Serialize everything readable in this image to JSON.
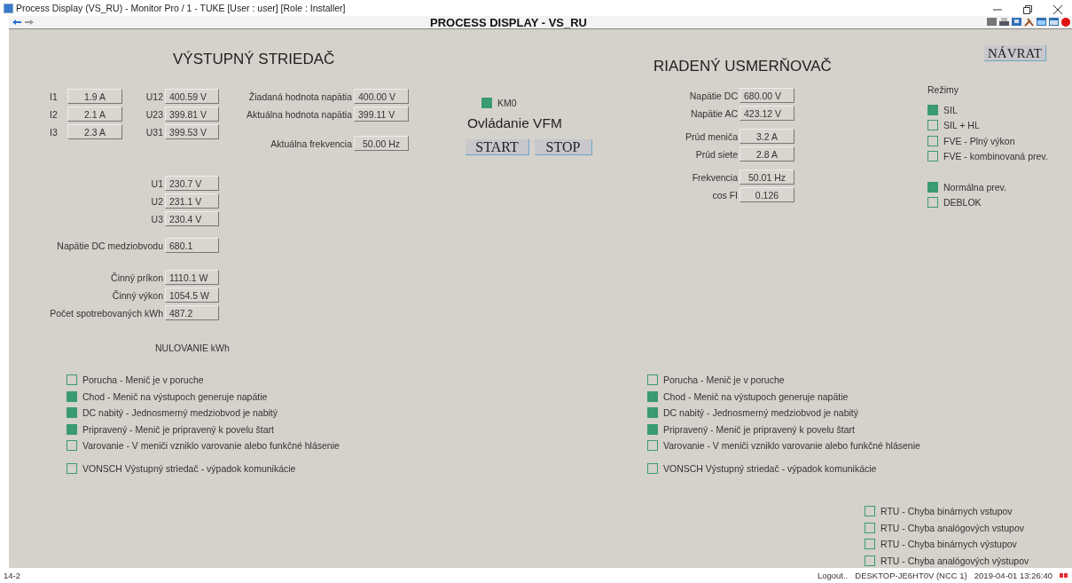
{
  "window": {
    "title": "Process Display (VS_RU) - Monitor Pro / 1 - TUKE [User : user] [Role : Installer]"
  },
  "toolbar": {
    "title": "PROCESS DISPLAY - VS_RU"
  },
  "inverter": {
    "title": "VÝSTUPNÝ STRIEDAČ",
    "currents": [
      {
        "label": "I1",
        "value": "1.9 A"
      },
      {
        "label": "I2",
        "value": "2.1 A"
      },
      {
        "label": "I3",
        "value": "2.3 A"
      }
    ],
    "line_voltages": [
      {
        "label": "U12",
        "value": "400.59 V"
      },
      {
        "label": "U23",
        "value": "399.81 V"
      },
      {
        "label": "U31",
        "value": "399.53 V"
      }
    ],
    "setpoints": [
      {
        "label": "Žiadaná hodnota napätia",
        "value": "400.00 V"
      },
      {
        "label": "Aktuálna hodnota napätia",
        "value": "399.11 V"
      }
    ],
    "frequency": {
      "label": "Aktuálna frekvencia",
      "value": "50.00 Hz"
    },
    "phase_voltages": [
      {
        "label": "U1",
        "value": "230.7 V"
      },
      {
        "label": "U2",
        "value": "231.1 V"
      },
      {
        "label": "U3",
        "value": "230.4 V"
      }
    ],
    "dc_link": {
      "label": "Napätie DC medziobvodu",
      "value": "680.1"
    },
    "power": [
      {
        "label": "Činný príkon",
        "value": "1110.1 W"
      },
      {
        "label": "Činný výkon",
        "value": "1054.5 W"
      },
      {
        "label": "Počet spotrebovaných kWh",
        "value": "487.2"
      }
    ],
    "reset": "NULOVANIE kWh",
    "status": [
      {
        "label": "Porucha - Menič je v poruche",
        "on": false
      },
      {
        "label": "Chod - Menič na výstupoch generuje napätie",
        "on": true
      },
      {
        "label": "DC nabitý - Jednosmerný medziobvod je nabitý",
        "on": true
      },
      {
        "label": "Pripravený - Menič je pripravený k povelu štart",
        "on": true
      },
      {
        "label": "Varovanie - V meniči vzniklo varovanie alebo funkčné hlásenie",
        "on": false
      }
    ],
    "comm": {
      "label": "VONSCH Výstupný striedač - výpadok komunikácie",
      "on": false
    }
  },
  "control": {
    "km0": {
      "label": "KM0",
      "on": true
    },
    "title": "Ovládanie VFM",
    "buttons": [
      "START",
      "STOP"
    ]
  },
  "rectifier": {
    "title": "RIADENÝ USMERŇOVAČ",
    "return_button": "NÁVRAT",
    "measurements": [
      [
        {
          "label": "Napätie DC",
          "value": "680.00 V"
        },
        {
          "label": "Napätie AC",
          "value": "423.12 V"
        }
      ],
      [
        {
          "label": "Prúd meniča",
          "value": "3.2 A"
        },
        {
          "label": "Prúd siete",
          "value": "2.8 A"
        }
      ],
      [
        {
          "label": "Frekvencia",
          "value": "50.01 Hz"
        },
        {
          "label": "cos FI",
          "value": "0.126"
        }
      ]
    ],
    "modes_title": "Režimy",
    "modes": [
      {
        "label": "SIL",
        "on": true
      },
      {
        "label": "SIL + HL",
        "on": false
      },
      {
        "label": "FVE - Plný výkon",
        "on": false
      },
      {
        "label": "FVE - kombinovaná prev.",
        "on": false
      }
    ],
    "operation": [
      {
        "label": "Normálna prev.",
        "on": true
      },
      {
        "label": "DEBLOK",
        "on": false
      }
    ],
    "status": [
      {
        "label": "Porucha - Menič je v poruche",
        "on": false
      },
      {
        "label": "Chod - Menič na výstupoch generuje napätie",
        "on": true
      },
      {
        "label": "DC nabitý - Jednosmerný medziobvod je nabitý",
        "on": true
      },
      {
        "label": "Pripravený - Menič je pripravený k povelu štart",
        "on": true
      },
      {
        "label": "Varovanie - V meniči vzniklo varovanie alebo funkčné hlásenie",
        "on": false
      }
    ],
    "comm": {
      "label": "VONSCH Výstupný striedač - výpadok komunikácie",
      "on": false
    }
  },
  "rtu": [
    {
      "label": "RTU - Chyba binárnych vstupov",
      "on": false
    },
    {
      "label": "RTU - Chyba analógových vstupov",
      "on": false
    },
    {
      "label": "RTU - Chyba binárnych výstupov",
      "on": false
    },
    {
      "label": "RTU - Chyba analógových výstupov",
      "on": false
    }
  ],
  "status_bar": {
    "left": "14-2",
    "logout": "Logout..",
    "host": "DESKTOP-JE6HT0V (NCC 1)",
    "datetime": "2019-04-01 13:26:40"
  }
}
